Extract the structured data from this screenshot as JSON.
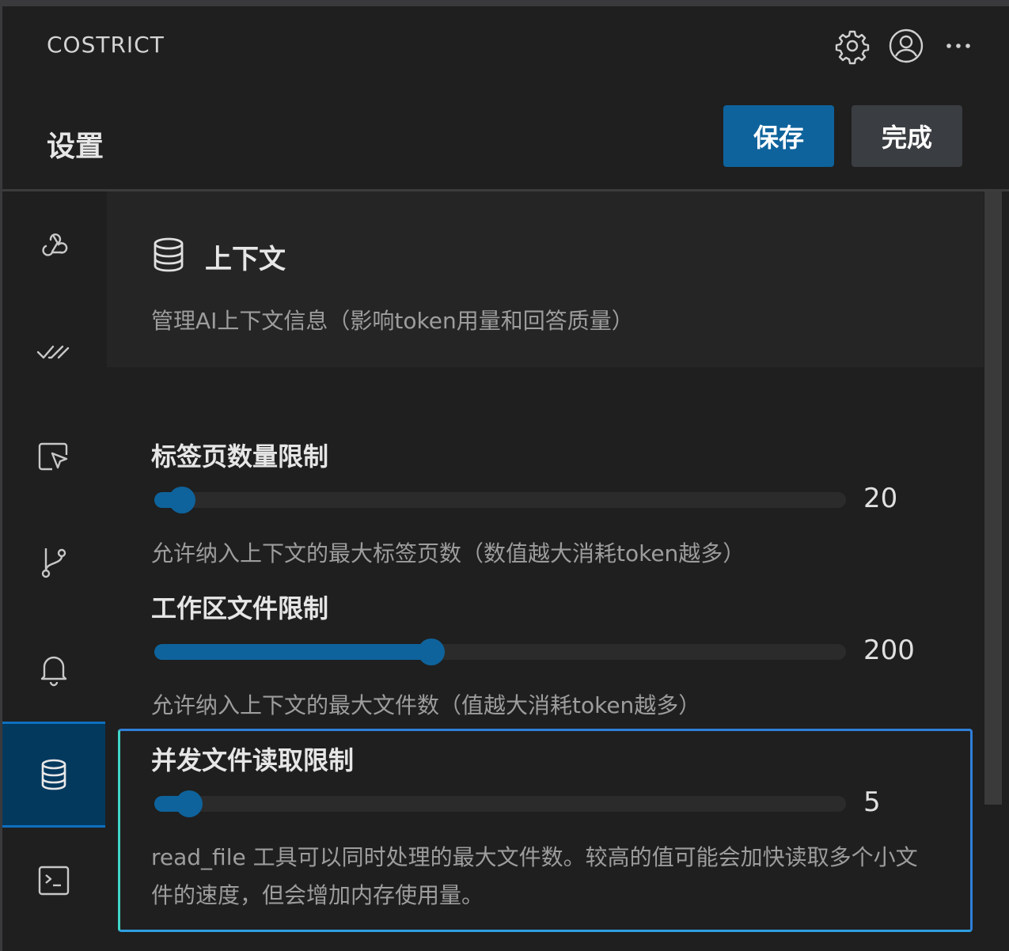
{
  "app": {
    "title": "COSTRICT"
  },
  "top_icons": [
    "gear-icon",
    "account-icon",
    "more-icon"
  ],
  "header": {
    "title": "设置",
    "save_label": "保存",
    "done_label": "完成"
  },
  "sidebar": {
    "items": [
      {
        "icon": "webhook-icon"
      },
      {
        "icon": "double-check-icon"
      },
      {
        "icon": "cursor-box-icon"
      },
      {
        "icon": "git-branch-icon"
      },
      {
        "icon": "bell-icon"
      },
      {
        "icon": "database-icon",
        "active": true
      },
      {
        "icon": "terminal-icon"
      }
    ]
  },
  "section": {
    "icon": "database-icon",
    "title": "上下文",
    "description": "管理AI上下文信息（影响token用量和回答质量）"
  },
  "settings": [
    {
      "label": "标签页数量限制",
      "value": "20",
      "fill_fraction": 0.04,
      "description": "允许纳入上下文的最大标签页数（数值越大消耗token越多）"
    },
    {
      "label": "工作区文件限制",
      "value": "200",
      "fill_fraction": 0.4,
      "description": "允许纳入上下文的最大文件数（值越大消耗token越多）"
    },
    {
      "label": "并发文件读取限制",
      "value": "5",
      "fill_fraction": 0.05,
      "description": "read_file 工具可以同时处理的最大文件数。较高的值可能会加快读取多个小文件的速度，但会增加内存使用量。"
    }
  ],
  "colors": {
    "accent": "#0e639c",
    "background": "#1f1f1f",
    "panel": "#252526"
  }
}
